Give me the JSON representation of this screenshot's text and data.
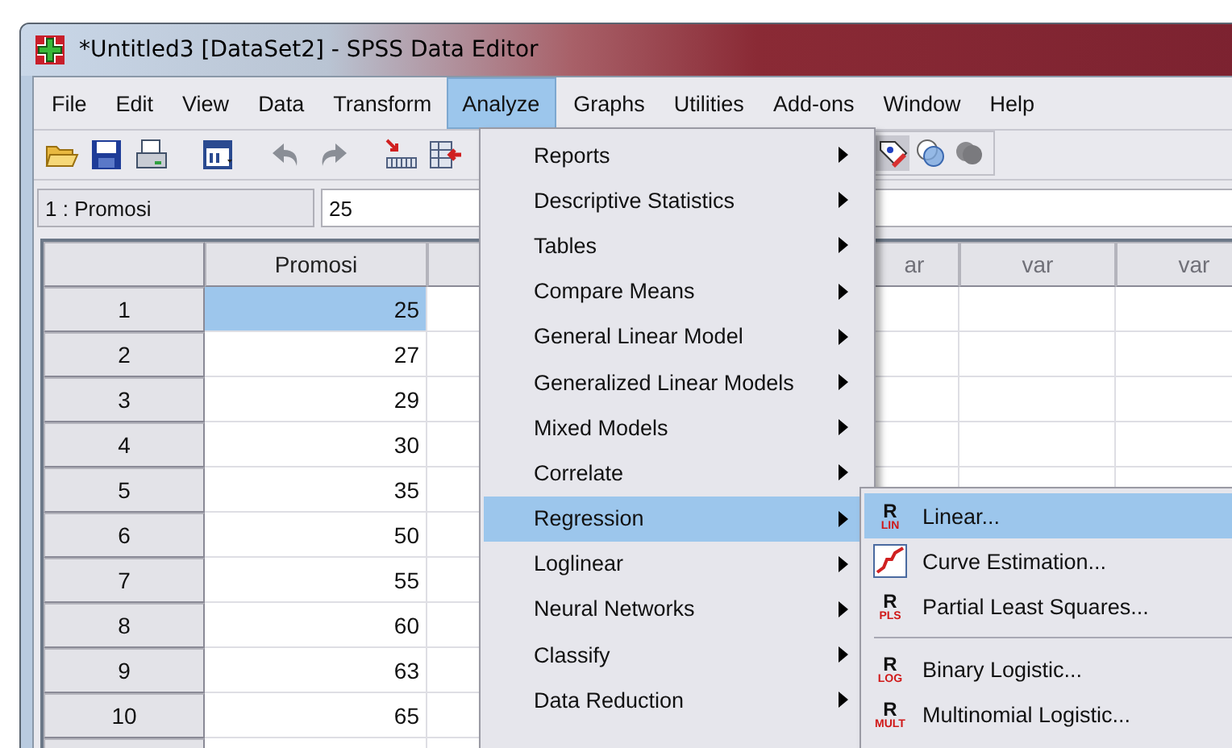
{
  "window": {
    "title": "*Untitled3 [DataSet2] - SPSS Data Editor"
  },
  "menu_bar": [
    {
      "label": "File",
      "selected": false
    },
    {
      "label": "Edit",
      "selected": false
    },
    {
      "label": "View",
      "selected": false
    },
    {
      "label": "Data",
      "selected": false
    },
    {
      "label": "Transform",
      "selected": false
    },
    {
      "label": "Analyze",
      "selected": true
    },
    {
      "label": "Graphs",
      "selected": false
    },
    {
      "label": "Utilities",
      "selected": false
    },
    {
      "label": "Add-ons",
      "selected": false
    },
    {
      "label": "Window",
      "selected": false
    },
    {
      "label": "Help",
      "selected": false
    }
  ],
  "cell_editor": {
    "cell": "1 : Promosi",
    "value": "25"
  },
  "grid": {
    "columns": [
      {
        "label": "Promosi"
      },
      {},
      {
        "label": "ar"
      },
      {
        "label": "var"
      },
      {
        "label": "var"
      }
    ],
    "rows": [
      {
        "label": "1",
        "value": "25",
        "selected": true
      },
      {
        "label": "2",
        "value": "27",
        "selected": false
      },
      {
        "label": "3",
        "value": "29",
        "selected": false
      },
      {
        "label": "4",
        "value": "30",
        "selected": false
      },
      {
        "label": "5",
        "value": "35",
        "selected": false
      },
      {
        "label": "6",
        "value": "50",
        "selected": false
      },
      {
        "label": "7",
        "value": "55",
        "selected": false
      },
      {
        "label": "8",
        "value": "60",
        "selected": false
      },
      {
        "label": "9",
        "value": "63",
        "selected": false
      },
      {
        "label": "10",
        "value": "65",
        "selected": false
      }
    ]
  },
  "analyze_menu": [
    {
      "label": "Reports",
      "selected": false
    },
    {
      "label": "Descriptive Statistics",
      "selected": false
    },
    {
      "label": "Tables",
      "selected": false
    },
    {
      "label": "Compare Means",
      "selected": false
    },
    {
      "label": "General Linear Model",
      "selected": false
    },
    {
      "label": "Generalized Linear Models",
      "selected": false
    },
    {
      "label": "Mixed Models",
      "selected": false
    },
    {
      "label": "Correlate",
      "selected": false
    },
    {
      "label": "Regression",
      "selected": true
    },
    {
      "label": "Loglinear",
      "selected": false
    },
    {
      "label": "Neural Networks",
      "selected": false
    },
    {
      "label": "Classify",
      "selected": false
    },
    {
      "label": "Data Reduction",
      "selected": false
    }
  ],
  "regression_menu": [
    {
      "kind": "badge",
      "label": "Linear...",
      "badge_top": "R",
      "badge_bottom": "LIN",
      "selected": true
    },
    {
      "kind": "chart",
      "label": "Curve Estimation...",
      "selected": false
    },
    {
      "kind": "badge",
      "label": "Partial Least Squares...",
      "badge_top": "R",
      "badge_bottom": "PLS",
      "selected": false
    },
    {
      "kind": "separator"
    },
    {
      "kind": "badge",
      "label": "Binary Logistic...",
      "badge_top": "R",
      "badge_bottom": "LOG",
      "selected": false
    },
    {
      "kind": "badge",
      "label": "Multinomial Logistic...",
      "badge_top": "R",
      "badge_bottom": "MULT",
      "selected": false
    }
  ]
}
